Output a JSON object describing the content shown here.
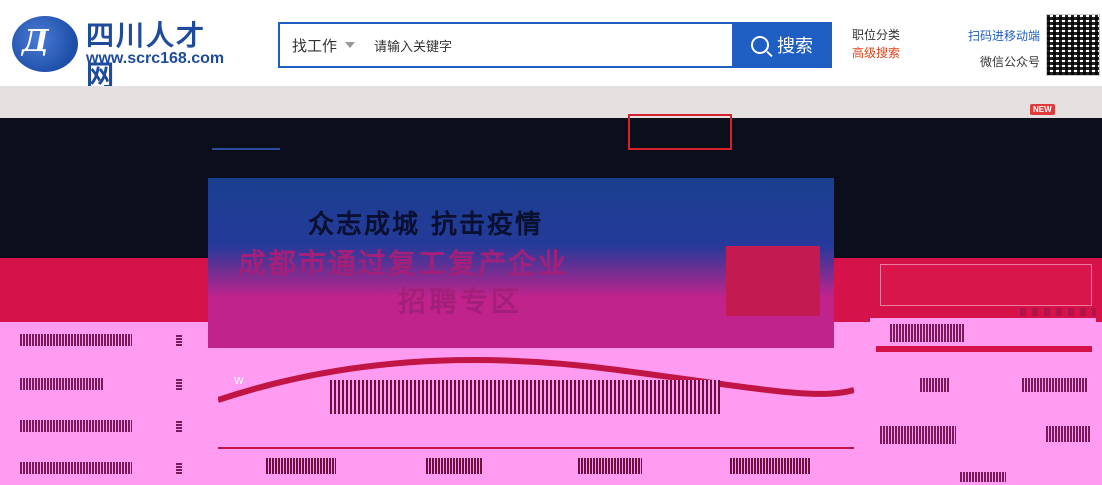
{
  "header": {
    "logo_cn": "四川人才网",
    "logo_en": "www.scrc168.com",
    "logo_mark": "Д"
  },
  "search": {
    "type_label": "找工作",
    "placeholder": "请输入关键字",
    "button_label": "搜索"
  },
  "links": {
    "category": "职位分类",
    "advanced": "高级搜索",
    "mobile": "扫码进移动端",
    "wechat": "微信公众号"
  },
  "nav": {
    "new_badge": "NEW"
  },
  "banner": {
    "line1": "众志成城 抗击疫情",
    "line2": "成都市通过复工复产企业",
    "line3": "招聘专区"
  },
  "colors": {
    "brand_blue": "#1f5fc4",
    "accent_red": "#e0431b",
    "banner_magenta": "#c0238c"
  }
}
